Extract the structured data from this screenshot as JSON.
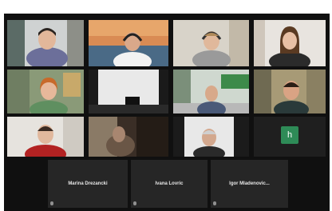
{
  "participants": {
    "names": {
      "n1": "Marina Drezancki",
      "n2": "Ivana Lovric",
      "n3": "Igor Mladenovic..."
    },
    "avatar_initial": "h"
  },
  "colors": {
    "background": "#101010",
    "name_tile": "#262626",
    "avatar": "#2e8b57"
  }
}
